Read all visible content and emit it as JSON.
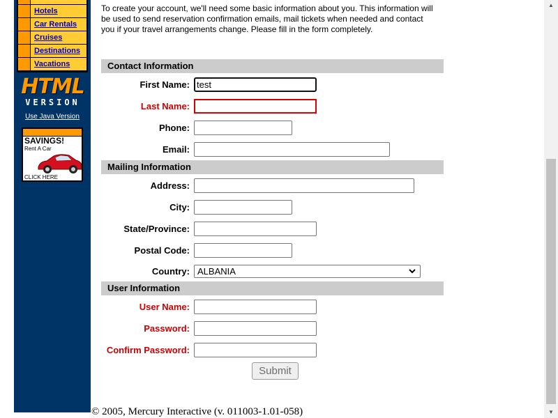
{
  "sidebar": {
    "nav_items": [
      {
        "label": ""
      },
      {
        "label": "Hotels"
      },
      {
        "label": "Car Rentals"
      },
      {
        "label": "Cruises"
      },
      {
        "label": "Destinations"
      },
      {
        "label": "Vacations"
      }
    ],
    "logo_line1": "HTML",
    "logo_line2": "VERSION",
    "java_link": "Use Java Version",
    "ad": {
      "title": "SAVINGS!",
      "subtitle": "Rent A Car",
      "cta": "CLICK HERE"
    }
  },
  "intro_text": "To create your account, we'll need some basic information about you. This information will be used to send reservation confirmation emails, mail tickets when needed and contact you if your travel arrangements change. Please fill in the form completely.",
  "sections": {
    "contact": "Contact Information",
    "mailing": "Mailing Information",
    "user": "User Information"
  },
  "labels": {
    "first_name": "First Name:",
    "last_name": "Last Name:",
    "phone": "Phone:",
    "email": "Email:",
    "address": "Address:",
    "city": "City:",
    "state": "State/Province:",
    "postal": "Postal Code:",
    "country": "Country:",
    "user_name": "User Name:",
    "password": "Password:",
    "confirm_password": "Confirm Password:"
  },
  "values": {
    "first_name": "test",
    "last_name": "",
    "phone": "",
    "email": "",
    "address": "",
    "city": "",
    "state": "",
    "postal": "",
    "country": "ALBANIA",
    "user_name": "",
    "password": "",
    "confirm_password": ""
  },
  "submit_label": "Submit",
  "footer": "© 2005, Mercury Interactive (v. 011003-1.01-058)",
  "colors": {
    "sidebar_bg": "#003366",
    "nav_bg": "#ffcc33",
    "accent_orange": "#ff9900",
    "required_label": "#cc0000",
    "section_bar": "#cccccc",
    "error_border": "#dd0000"
  }
}
